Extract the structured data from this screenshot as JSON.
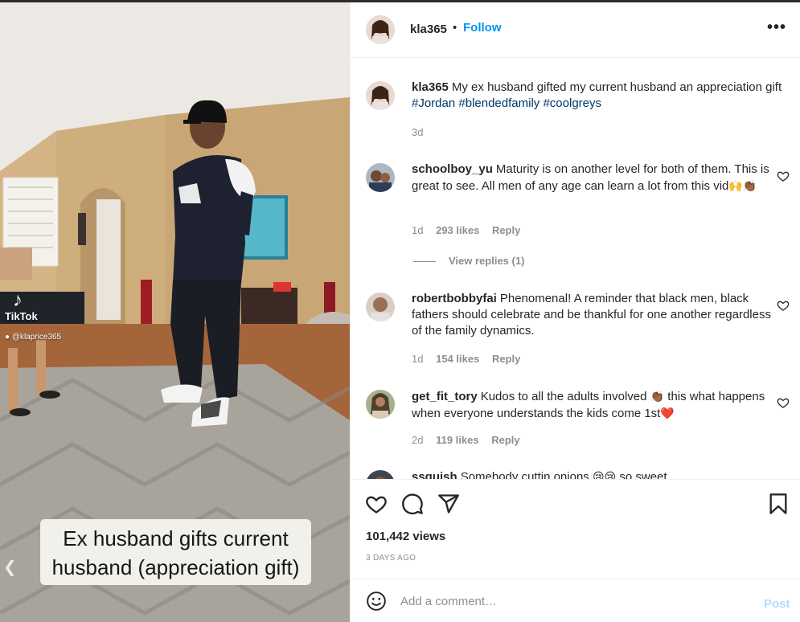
{
  "video": {
    "tiktok_label": "TikTok",
    "tiktok_handle": "@klaprice365",
    "caption": "Ex husband gifts current husband (appreciation gift)"
  },
  "header": {
    "username": "kla365",
    "separator": "•",
    "follow_label": "Follow",
    "more_label": "•••"
  },
  "post_caption": {
    "username": "kla365",
    "text": "My ex husband gifted my current husband an appreciation gift",
    "hashtags": [
      "#Jordan",
      "#blendedfamily",
      "#coolgreys"
    ],
    "time": "3d"
  },
  "comments": [
    {
      "username": "schoolboy_yu",
      "text": "Maturity is on another level for both of them. This is great to see. All men of any age can learn a lot from this vid",
      "emojis": "🙌👏🏾",
      "time": "1d",
      "likes": "293 likes",
      "reply_label": "Reply",
      "view_replies": "View replies (1)"
    },
    {
      "username": "robertbobbyfai",
      "text": "Phenomenal! A reminder that black men, black fathers should celebrate and be thankful for one another regardless of the family dynamics.",
      "time": "1d",
      "likes": "154 likes",
      "reply_label": "Reply"
    },
    {
      "username": "get_fit_tory",
      "text_before": "Kudos to all the adults involved",
      "emoji_mid": "👏🏾",
      "text_after": "this what happens when everyone understands the kids come 1st",
      "emoji_end": "❤️",
      "time": "2d",
      "likes": "119 likes",
      "reply_label": "Reply"
    },
    {
      "username": "ssquish",
      "text": "Somebody cuttin onions",
      "emojis": "😢😢",
      "text_after": "so sweet"
    }
  ],
  "actions": {
    "icons": [
      "heart-icon",
      "comment-icon",
      "share-icon",
      "bookmark-icon"
    ],
    "views": "101,442 views",
    "posted": "3 DAYS AGO"
  },
  "add_comment": {
    "placeholder": "Add a comment…",
    "post_label": "Post"
  },
  "colors": {
    "link_blue": "#0095f6",
    "hashtag": "#00376b",
    "muted": "#8e8e8e",
    "post_disabled": "#b3dbff"
  }
}
